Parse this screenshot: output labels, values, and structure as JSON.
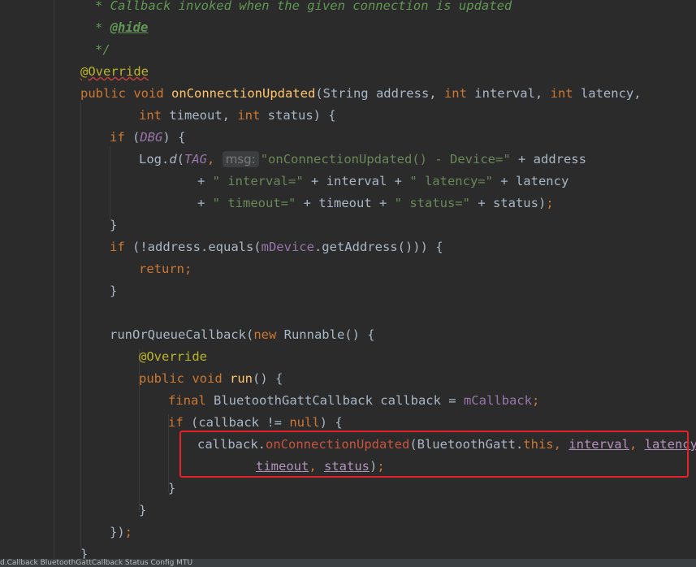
{
  "editor": {
    "lines": [
      {
        "indent": "  ",
        "tokens": [
          [
            "cm",
            "* Callback invoked when the given connection is updated"
          ]
        ]
      },
      {
        "indent": "  ",
        "tokens": [
          [
            "cm",
            "* "
          ],
          [
            "cm-tag",
            "@hide"
          ]
        ]
      },
      {
        "indent": "  ",
        "tokens": [
          [
            "cm",
            "*/"
          ]
        ]
      },
      {
        "indent": "",
        "tokens": [
          [
            "ann-wavy",
            "@Override"
          ]
        ]
      },
      {
        "indent": "",
        "tokens": [
          [
            "kw",
            "public "
          ],
          [
            "kw",
            "void "
          ],
          [
            "fn",
            "onConnectionUpdated"
          ],
          [
            "p",
            "(String address, "
          ],
          [
            "kw",
            "int "
          ],
          [
            "p",
            "interval, "
          ],
          [
            "kw",
            "int "
          ],
          [
            "p",
            "latency,"
          ]
        ]
      },
      {
        "indent": "        ",
        "tokens": [
          [
            "kw",
            "int "
          ],
          [
            "p",
            "timeout, "
          ],
          [
            "kw",
            "int "
          ],
          [
            "p",
            "status) {"
          ]
        ]
      },
      {
        "indent": "    ",
        "tokens": [
          [
            "kw",
            "if "
          ],
          [
            "p",
            "("
          ],
          [
            "fld-i",
            "DBG"
          ],
          [
            "p",
            ") {"
          ]
        ]
      },
      {
        "indent": "        ",
        "tokens": [
          [
            "p",
            "Log."
          ],
          [
            "st",
            "d"
          ],
          [
            "p",
            "("
          ],
          [
            "fld-i",
            "TAG"
          ],
          [
            "kw",
            ", "
          ],
          [
            "hint",
            "msg:"
          ],
          [
            "str",
            "\"onConnectionUpdated() - Device=\""
          ],
          [
            "p",
            " + address"
          ]
        ]
      },
      {
        "indent": "                ",
        "tokens": [
          [
            "p",
            "+ "
          ],
          [
            "str",
            "\" interval=\""
          ],
          [
            "p",
            " + interval + "
          ],
          [
            "str",
            "\" latency=\""
          ],
          [
            "p",
            " + latency"
          ]
        ]
      },
      {
        "indent": "                ",
        "tokens": [
          [
            "p",
            "+ "
          ],
          [
            "str",
            "\" timeout=\""
          ],
          [
            "p",
            " + timeout + "
          ],
          [
            "str",
            "\" status=\""
          ],
          [
            "p",
            " + status)"
          ],
          [
            "kw",
            ";"
          ]
        ]
      },
      {
        "indent": "    ",
        "tokens": [
          [
            "p",
            "}"
          ]
        ]
      },
      {
        "indent": "    ",
        "tokens": [
          [
            "kw",
            "if "
          ],
          [
            "p",
            "(!address.equals("
          ],
          [
            "fld",
            "mDevice"
          ],
          [
            "p",
            ".getAddress())) {"
          ]
        ]
      },
      {
        "indent": "        ",
        "tokens": [
          [
            "kw",
            "return;"
          ]
        ]
      },
      {
        "indent": "    ",
        "tokens": [
          [
            "p",
            "}"
          ]
        ]
      },
      {
        "indent": "",
        "tokens": []
      },
      {
        "indent": "    ",
        "tokens": [
          [
            "p",
            "runOrQueueCallback("
          ],
          [
            "kw",
            "new "
          ],
          [
            "p",
            "Runnable() {"
          ]
        ]
      },
      {
        "indent": "        ",
        "tokens": [
          [
            "ann",
            "@Override"
          ]
        ]
      },
      {
        "indent": "        ",
        "tokens": [
          [
            "kw",
            "public "
          ],
          [
            "kw",
            "void "
          ],
          [
            "fn",
            "run"
          ],
          [
            "p",
            "() {"
          ]
        ]
      },
      {
        "indent": "            ",
        "tokens": [
          [
            "kw",
            "final "
          ],
          [
            "p",
            "BluetoothGattCallback callback = "
          ],
          [
            "fld",
            "mCallback"
          ],
          [
            "kw",
            ";"
          ]
        ]
      },
      {
        "indent": "            ",
        "tokens": [
          [
            "kw",
            "if "
          ],
          [
            "p",
            "(callback != "
          ],
          [
            "kw",
            "null"
          ],
          [
            "p",
            ") {"
          ]
        ]
      },
      {
        "indent": "                ",
        "tokens": [
          [
            "p",
            "callback."
          ],
          [
            "red",
            "onConnectionUpdated"
          ],
          [
            "p",
            "(BluetoothGatt."
          ],
          [
            "kw",
            "this"
          ],
          [
            "kw",
            ", "
          ],
          [
            "ul",
            "interval"
          ],
          [
            "kw",
            ", "
          ],
          [
            "ul",
            "latency"
          ],
          [
            "kw",
            ","
          ]
        ]
      },
      {
        "indent": "                        ",
        "tokens": [
          [
            "ul",
            "timeout"
          ],
          [
            "kw",
            ", "
          ],
          [
            "ul",
            "status"
          ],
          [
            "p",
            ")"
          ],
          [
            "kw",
            ";"
          ]
        ]
      },
      {
        "indent": "            ",
        "tokens": [
          [
            "p",
            "}"
          ]
        ]
      },
      {
        "indent": "        ",
        "tokens": [
          [
            "p",
            "}"
          ]
        ]
      },
      {
        "indent": "    ",
        "tokens": [
          [
            "p",
            "})"
          ],
          [
            "kw",
            ";"
          ]
        ]
      },
      {
        "indent": "",
        "tokens": [
          [
            "p",
            "}"
          ]
        ]
      }
    ]
  },
  "status_strip": "d.Callback     BluetoothGattCallback            Status     Config     MTU"
}
